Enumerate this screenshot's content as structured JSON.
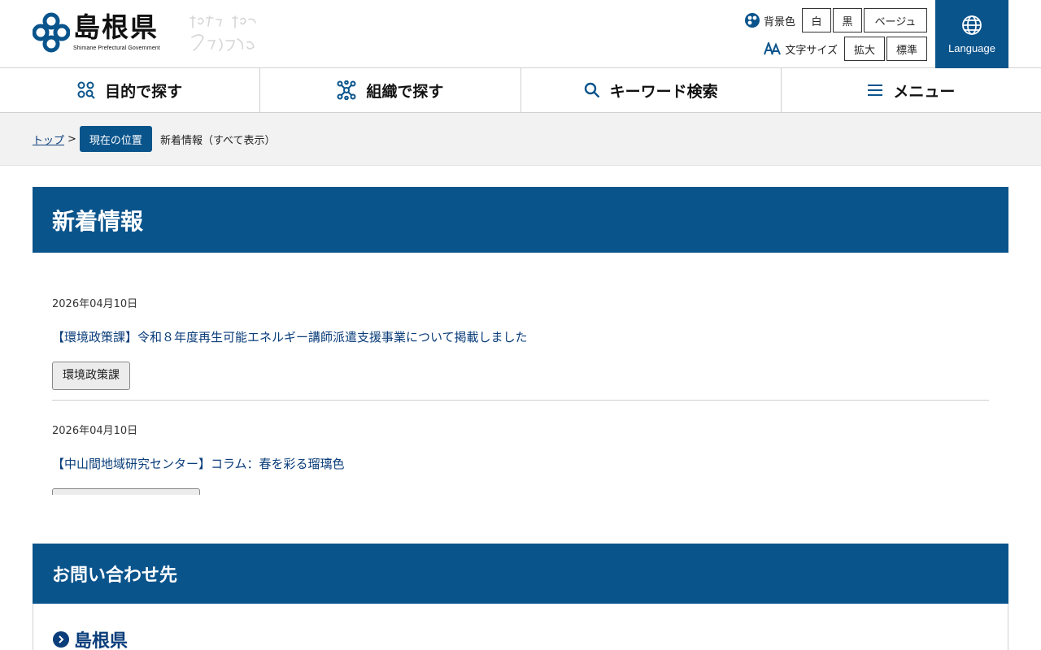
{
  "header": {
    "logo_title": "島根県",
    "logo_subtitle": "Shimane Prefectural Government",
    "bg_color_label": "背景色",
    "bg_options": [
      "白",
      "黒",
      "ベージュ"
    ],
    "font_size_label": "文字サイズ",
    "font_options": [
      "拡大",
      "標準"
    ],
    "language_label": "Language"
  },
  "nav": {
    "items": [
      {
        "label": "目的で探す",
        "icon": "purpose-icon"
      },
      {
        "label": "組織で探す",
        "icon": "organization-icon"
      },
      {
        "label": "キーワード検索",
        "icon": "search-icon"
      },
      {
        "label": "メニュー",
        "icon": "menu-icon"
      }
    ]
  },
  "breadcrumb": {
    "top": "トップ",
    "separator": ">",
    "here_badge": "現在の位置",
    "current": "新着情報（すべて表示）"
  },
  "main": {
    "title": "新着情報",
    "news": [
      {
        "date": "2026年04月10日",
        "title": "【環境政策課】令和８年度再生可能エネルギー講師派遣支援事業について掲載しました",
        "tag": "環境政策課"
      },
      {
        "date": "2026年04月10日",
        "title": "【中山間地域研究センター】コラム：春を彩る瑠璃色",
        "tag": ""
      }
    ]
  },
  "contact": {
    "title": "お問い合わせ先",
    "org": "島根県"
  },
  "colors": {
    "brand_blue": "#0a548c",
    "link_blue": "#0a3d7a"
  }
}
